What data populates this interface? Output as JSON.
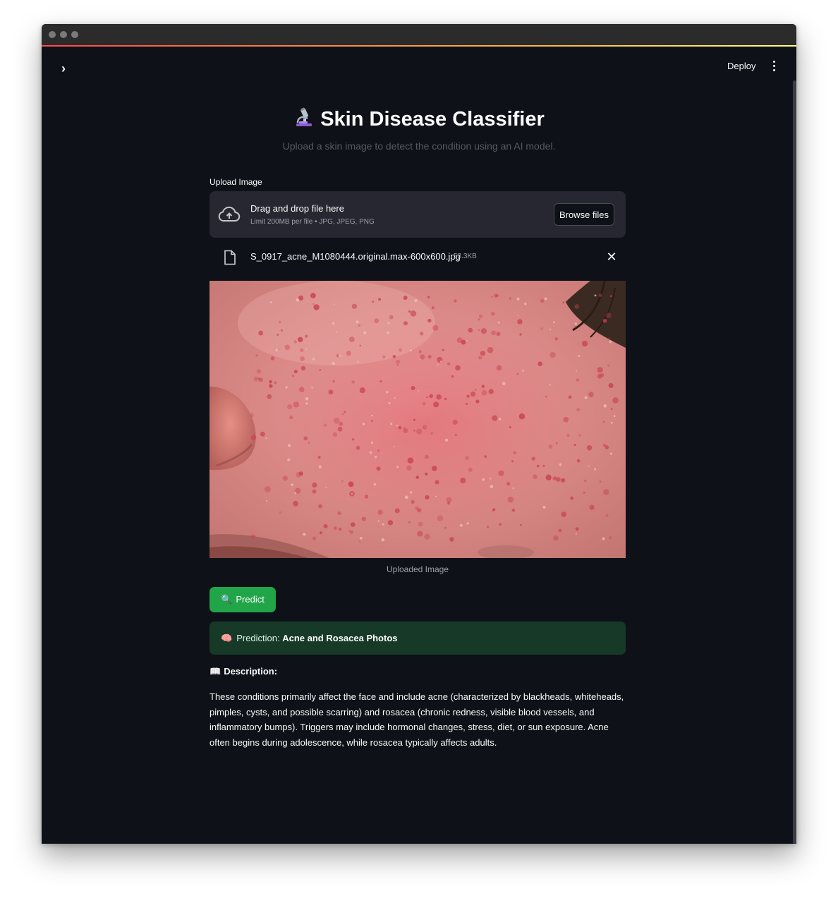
{
  "header": {
    "deploy_label": "Deploy"
  },
  "main": {
    "title": "Skin Disease Classifier",
    "subtitle": "Upload a skin image to detect the condition using an AI model.",
    "uploader": {
      "label": "Upload Image",
      "drop_text": "Drag and drop file here",
      "limit_text": "Limit 200MB per file • JPG, JPEG, PNG",
      "browse_label": "Browse files"
    },
    "file": {
      "name": "S_0917_acne_M1080444.original.max-600x600.jpg",
      "size": "53.3KB"
    },
    "image_caption": "Uploaded Image",
    "predict_label": "Predict",
    "prediction": {
      "prefix": "Prediction:",
      "value": "Acne and Rosacea Photos"
    },
    "description": {
      "heading": "Description:",
      "body": "These conditions primarily affect the face and include acne (characterized by blackheads, whiteheads, pimples, cysts, and possible scarring) and rosacea (chronic redness, visible blood vessels, and inflammatory bumps). Triggers may include hormonal changes, stress, diet, or sun exposure. Acne often begins during adolescence, while rosacea typically affects adults."
    }
  },
  "icons": {
    "sidebar_toggle": "chevron-right-icon",
    "menu": "vertical-dots-icon",
    "title": "microscope-icon",
    "upload": "cloud-upload-icon",
    "file": "file-icon",
    "remove": "close-icon",
    "predict": "magnifier-icon",
    "prediction": "brain-icon",
    "description": "book-icon"
  },
  "colors": {
    "background": "#0e1117",
    "predict_button": "#21a548",
    "prediction_box": "#173928",
    "uploader_bg": "#262730"
  }
}
